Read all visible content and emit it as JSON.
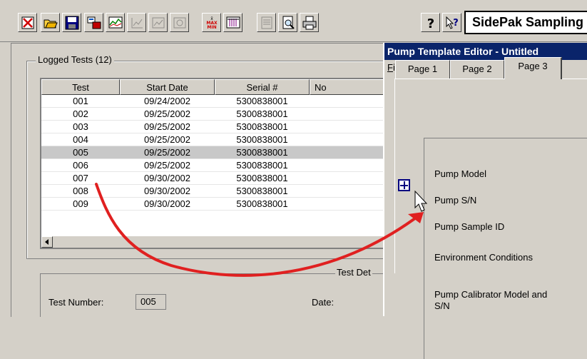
{
  "toolbar": {
    "buttons": [
      {
        "name": "delete-icon",
        "enabled": true
      },
      {
        "name": "open-folder-icon",
        "enabled": true
      },
      {
        "name": "save-disk-icon",
        "enabled": true
      },
      {
        "name": "download-data-icon",
        "enabled": true
      },
      {
        "name": "graph-icon",
        "enabled": true
      },
      {
        "name": "graph-edit-icon",
        "enabled": false
      },
      {
        "name": "graph-settings-icon",
        "enabled": false
      },
      {
        "name": "graph-zoom-icon",
        "enabled": false
      },
      {
        "name": "statistics-icon",
        "enabled": true
      },
      {
        "name": "table-icon",
        "enabled": true
      },
      {
        "name": "report-setup-icon",
        "enabled": false
      },
      {
        "name": "print-preview-icon",
        "enabled": true
      },
      {
        "name": "print-icon",
        "enabled": true
      },
      {
        "name": "help-icon",
        "enabled": true
      },
      {
        "name": "context-help-icon",
        "enabled": true
      }
    ],
    "stats_icon_text": {
      "top": "MAX",
      "bottom": "MIN"
    },
    "app_title": "SidePak Sampling"
  },
  "logged_tests": {
    "title": "Logged Tests (12)",
    "columns": [
      "Test",
      "Start Date",
      "Serial #",
      "No"
    ],
    "selected_index": 4,
    "rows": [
      {
        "test": "001",
        "date": "09/24/2002",
        "serial": "5300838001"
      },
      {
        "test": "002",
        "date": "09/25/2002",
        "serial": "5300838001"
      },
      {
        "test": "003",
        "date": "09/25/2002",
        "serial": "5300838001"
      },
      {
        "test": "004",
        "date": "09/25/2002",
        "serial": "5300838001"
      },
      {
        "test": "005",
        "date": "09/25/2002",
        "serial": "5300838001"
      },
      {
        "test": "006",
        "date": "09/25/2002",
        "serial": "5300838001"
      },
      {
        "test": "007",
        "date": "09/30/2002",
        "serial": "5300838001"
      },
      {
        "test": "008",
        "date": "09/30/2002",
        "serial": "5300838001"
      },
      {
        "test": "009",
        "date": "09/30/2002",
        "serial": "5300838001"
      }
    ]
  },
  "test_details": {
    "title": "Test Det",
    "test_number_label": "Test Number:",
    "test_number_value": "005",
    "date_label": "Date:"
  },
  "editor": {
    "title": "Pump Template Editor - Untitled",
    "menu_file": "File",
    "tabs": [
      "Page 1",
      "Page 2",
      "Page 3"
    ],
    "active_tab": 2,
    "fields": [
      "Pump Model",
      "Pump S/N",
      "Pump Sample ID",
      "Environment Conditions",
      "Pump Calibrator Model and",
      "S/N"
    ]
  },
  "colors": {
    "titlebar": "#0a246a",
    "selection": "#c8c8c8",
    "annotation_arrow": "#e02020"
  }
}
